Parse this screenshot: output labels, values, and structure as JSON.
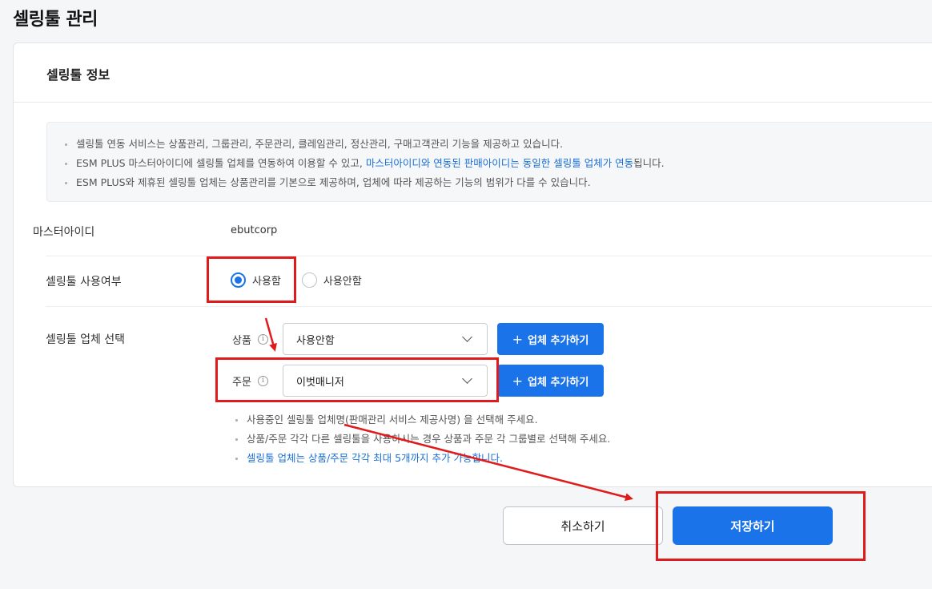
{
  "page": {
    "title": "셀링툴 관리"
  },
  "card": {
    "title": "셀링툴 정보"
  },
  "notice": {
    "line1": "셀링툴 연동 서비스는 상품관리, 그룹관리, 주문관리, 클레임관리, 정산관리, 구매고객관리 기능을 제공하고 있습니다.",
    "line2_pre": "ESM PLUS 마스터아이디에 셀링툴 업체를 연동하여 이용할 수 있고, ",
    "line2_hl1": "마스터아이디와 연동된 판매아이디는 동일한 셀링툴 업체가 연동",
    "line2_post": "됩니다.",
    "line3": "ESM PLUS와 제휴된 셀링툴 업체는 상품관리를 기본으로 제공하며, 업체에 따라 제공하는 기능의 범위가 다를 수 있습니다."
  },
  "master": {
    "label": "마스터아이디",
    "value": "ebutcorp"
  },
  "usage": {
    "label": "셀링툴 사용여부",
    "options": [
      "사용함",
      "사용안함"
    ],
    "selected": "사용함"
  },
  "vendor": {
    "label": "셀링툴 업체 선택",
    "product_label": "상품",
    "product_value": "사용안함",
    "order_label": "주문",
    "order_value": "이벗매니저",
    "add_label": "업체 추가하기",
    "info_glyph": "i",
    "plus_glyph": "+"
  },
  "help": {
    "line1": "사용중인 셀링툴 업체명(판매관리 서비스 제공사명) 을 선택해 주세요.",
    "line2": "상품/주문 각각 다른 셀링툴을 사용하시는 경우 상품과 주문 각 그룹별로 선택해 주세요.",
    "line3": "셀링툴 업체는 상품/주문 각각 최대 5개까지 추가 가능합니다."
  },
  "actions": {
    "cancel": "취소하기",
    "save": "저장하기"
  },
  "colors": {
    "accent": "#1a73e8",
    "annotation": "#e01b1b"
  },
  "annotations": [
    {
      "name": "usage-radio-highlight",
      "color": "#e01b1b"
    },
    {
      "name": "order-field-highlight",
      "color": "#e01b1b"
    },
    {
      "name": "save-button-highlight",
      "color": "#e01b1b"
    }
  ]
}
